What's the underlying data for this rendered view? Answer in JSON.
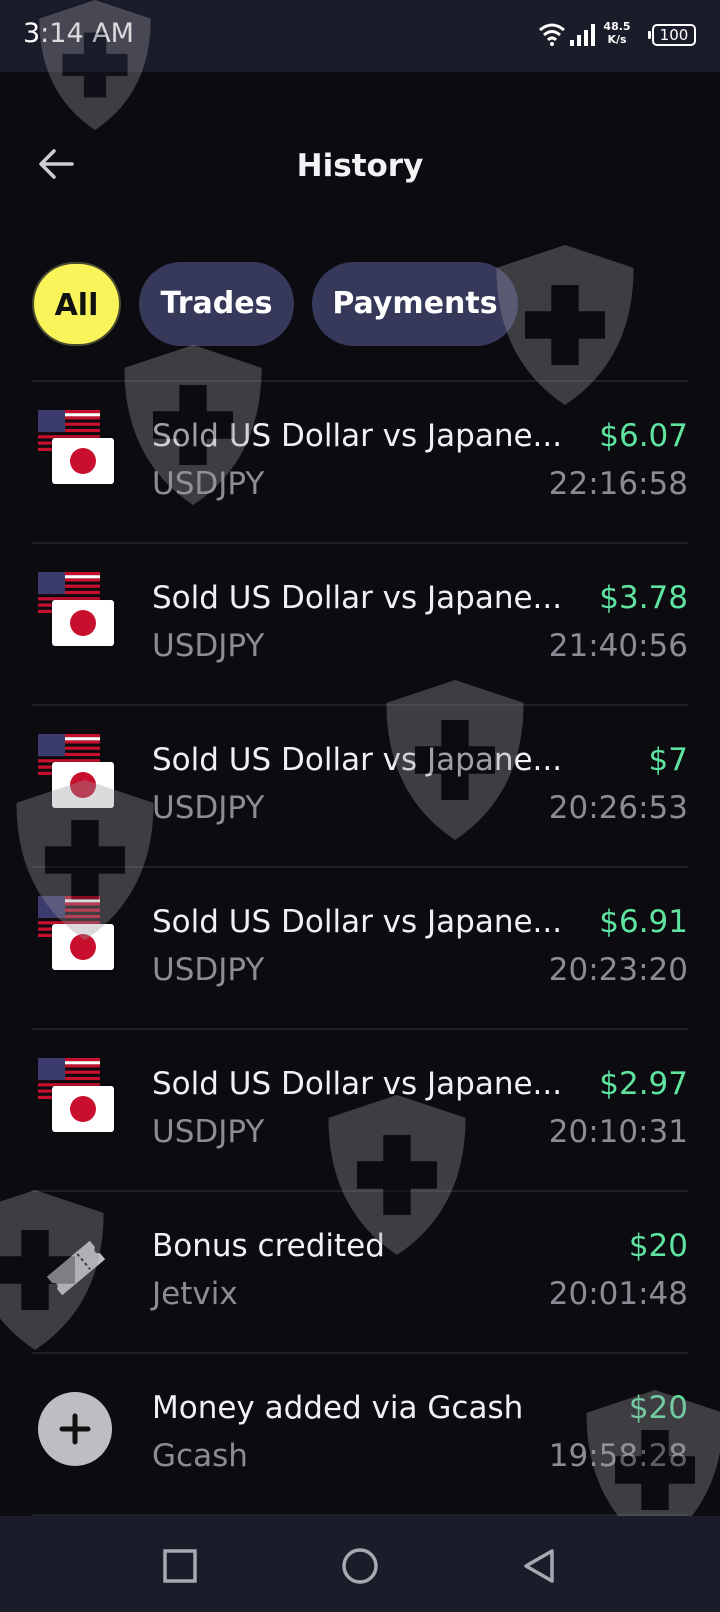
{
  "status_bar": {
    "time": "3:14 AM",
    "net_speed_value": "48.5",
    "net_speed_unit": "K/s",
    "battery": "100"
  },
  "header": {
    "title": "History",
    "back_icon": "arrow-left-icon"
  },
  "filters": [
    {
      "label": "All",
      "active": true
    },
    {
      "label": "Trades",
      "active": false
    },
    {
      "label": "Payments",
      "active": false
    }
  ],
  "transactions": [
    {
      "title": "Sold US Dollar vs Japane...",
      "subtitle": "USDJPY",
      "amount": "$6.07",
      "time": "22:16:58",
      "icon": "usd-jpy-flags-icon"
    },
    {
      "title": "Sold US Dollar vs Japane...",
      "subtitle": "USDJPY",
      "amount": "$3.78",
      "time": "21:40:56",
      "icon": "usd-jpy-flags-icon"
    },
    {
      "title": "Sold US Dollar vs Japane...",
      "subtitle": "USDJPY",
      "amount": "$7",
      "time": "20:26:53",
      "icon": "usd-jpy-flags-icon"
    },
    {
      "title": "Sold US Dollar vs Japane...",
      "subtitle": "USDJPY",
      "amount": "$6.91",
      "time": "20:23:20",
      "icon": "usd-jpy-flags-icon"
    },
    {
      "title": "Sold US Dollar vs Japane...",
      "subtitle": "USDJPY",
      "amount": "$2.97",
      "time": "20:10:31",
      "icon": "usd-jpy-flags-icon"
    },
    {
      "title": "Bonus credited",
      "subtitle": "Jetvix",
      "amount": "$20",
      "time": "20:01:48",
      "icon": "ticket-icon"
    },
    {
      "title": "Money added via Gcash",
      "subtitle": "Gcash",
      "amount": "$20",
      "time": "19:58:28",
      "icon": "plus-circle-icon"
    }
  ],
  "nav_bar": {
    "recents_icon": "square-icon",
    "home_icon": "circle-icon",
    "back_icon": "triangle-back-icon"
  },
  "colors": {
    "background": "#0b0b10",
    "chip_active": "#f8f45a",
    "chip_inactive": "#36395a",
    "amount_positive": "#5fe3a0",
    "secondary_text": "#8c8c96"
  }
}
